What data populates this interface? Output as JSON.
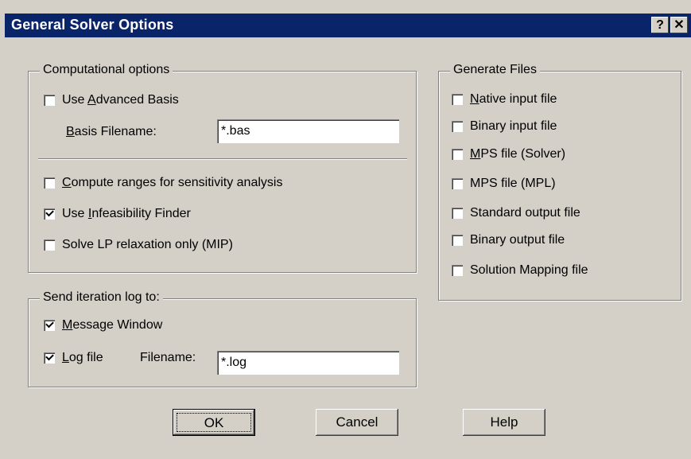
{
  "window": {
    "title": "General Solver Options",
    "help_glyph": "?",
    "close_glyph": "✕"
  },
  "computational": {
    "legend": "Computational options",
    "use_advanced_basis": {
      "pre": "Use ",
      "key": "A",
      "post": "dvanced Basis",
      "checked": false
    },
    "basis_filename": {
      "key": "B",
      "post": "asis Filename:",
      "value": "*.bas"
    },
    "compute_ranges": {
      "key": "C",
      "post": "ompute ranges for sensitivity analysis",
      "checked": false
    },
    "use_infeasibility": {
      "pre": "Use ",
      "key": "I",
      "post": "nfeasibility Finder",
      "checked": true
    },
    "solve_lp": {
      "label": "Solve LP relaxation only (MIP)",
      "checked": false
    }
  },
  "iteration_log": {
    "legend": "Send iteration log to:",
    "message_window": {
      "key": "M",
      "post": "essage Window",
      "checked": true
    },
    "log_file": {
      "key": "L",
      "post": "og file",
      "checked": true
    },
    "filename_label": "Filename:",
    "filename_value": "*.log"
  },
  "generate_files": {
    "legend": "Generate Files",
    "items": [
      {
        "key": "N",
        "post": "ative input file",
        "checked": false
      },
      {
        "pre": "Binary input file",
        "checked": false
      },
      {
        "key": "M",
        "post": "PS file (Solver)",
        "checked": false
      },
      {
        "pre": "MPS file (MPL)",
        "checked": false
      },
      {
        "pre": "Standard output file",
        "checked": false
      },
      {
        "pre": "Binary output file",
        "checked": false
      },
      {
        "pre": "Solution Mapping file",
        "checked": false
      }
    ]
  },
  "buttons": {
    "ok": "OK",
    "cancel": "Cancel",
    "help": "Help"
  },
  "colors": {
    "title_bar": "#0a246a",
    "face": "#d4d0c8"
  }
}
